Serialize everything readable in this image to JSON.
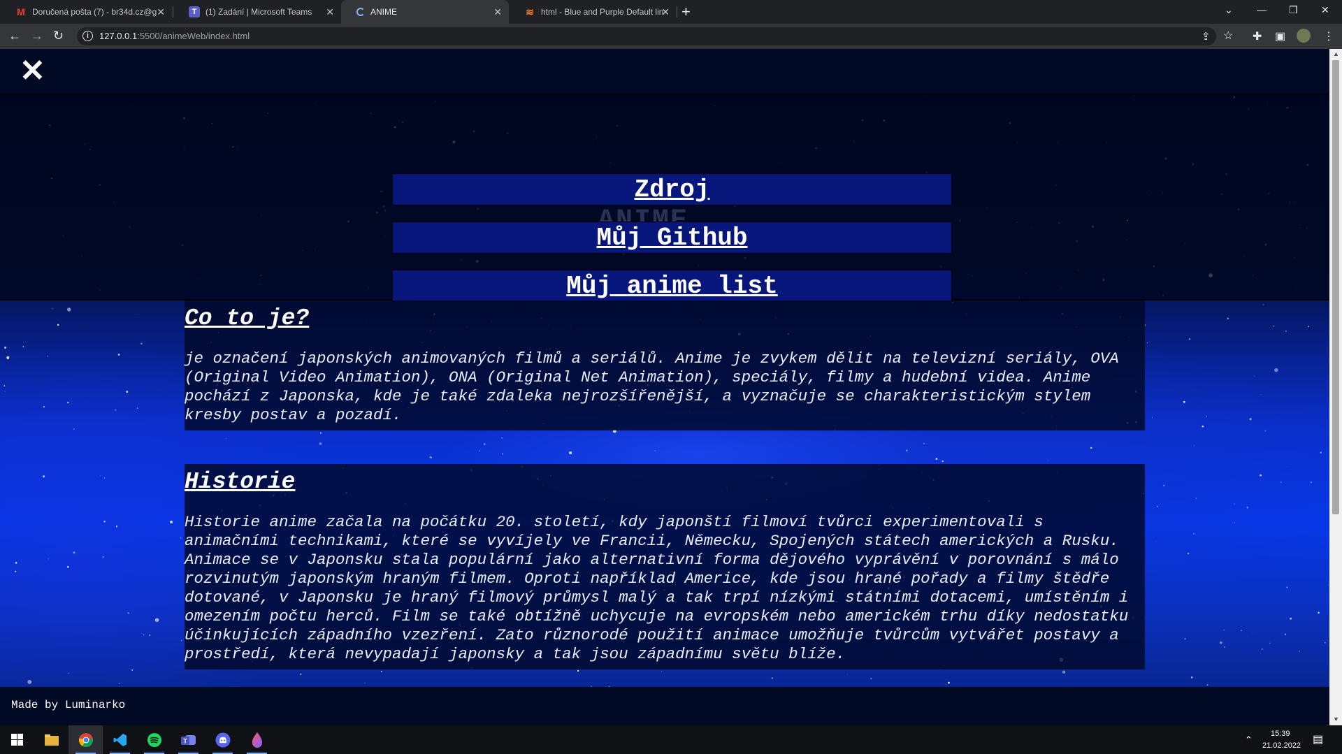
{
  "browser": {
    "tabs": [
      {
        "label": "Doručená pošta (7) - br34d.cz@g",
        "icon": "gmail-icon",
        "active": false
      },
      {
        "label": "(1) Zadání | Microsoft Teams",
        "icon": "teams-icon",
        "active": false
      },
      {
        "label": "ANIME",
        "icon": "loading-icon",
        "active": true
      },
      {
        "label": "html - Blue and Purple Default lin",
        "icon": "stackoverflow-icon",
        "active": false
      }
    ],
    "url_host": "127.0.0.1",
    "url_rest": ":5500/animeWeb/index.html"
  },
  "page": {
    "menu": {
      "ghost_heading": "ANIME",
      "links": [
        "Zdroj",
        "Můj Github",
        "Můj anime list"
      ]
    },
    "sections": [
      {
        "title": "Co to je?",
        "text": "je označení japonských animovaných filmů a seriálů. Anime je zvykem dělit na televizní seriály, OVA (Original Video Animation), ONA (Original Net Animation), speciály, filmy a hudební videa. Anime pochází z Japonska, kde je také zdaleka nejrozšířenější, a vyznačuje se charakteristickým stylem kresby postav a pozadí."
      },
      {
        "title": "Historie",
        "text": "Historie anime začala na počátku 20. století, kdy japonští filmoví tvůrci experimentovali s animačními technikami, které se vyvíjely ve Francii, Německu, Spojených státech amerických a Rusku. Animace se v Japonsku stala populární jako alternativní forma dějového vyprávění v porovnání s málo rozvinutým japonským hraným filmem. Oproti například Americe, kde jsou hrané pořady a filmy štědře dotované, v Japonsku je hraný filmový průmysl malý a tak trpí nízkými státními dotacemi, umístěním i omezením počtu herců. Film se také obtížně uchycuje na evropském nebo americkém trhu díky nedostatku účinkujících západního vzezření. Zato různorodé použití animace umožňuje tvůrcům vytvářet postavy a prostředí, která nevypadají japonsky a tak jsou západnímu světu blíže."
      }
    ],
    "footer": "Made by Luminarko"
  },
  "taskbar": {
    "time": "15:39",
    "date": "21.02.2022"
  },
  "colors": {
    "menu_link_bg": "#06167a",
    "topbar_bg": "#000a24",
    "space_blue": "#0637e8"
  }
}
